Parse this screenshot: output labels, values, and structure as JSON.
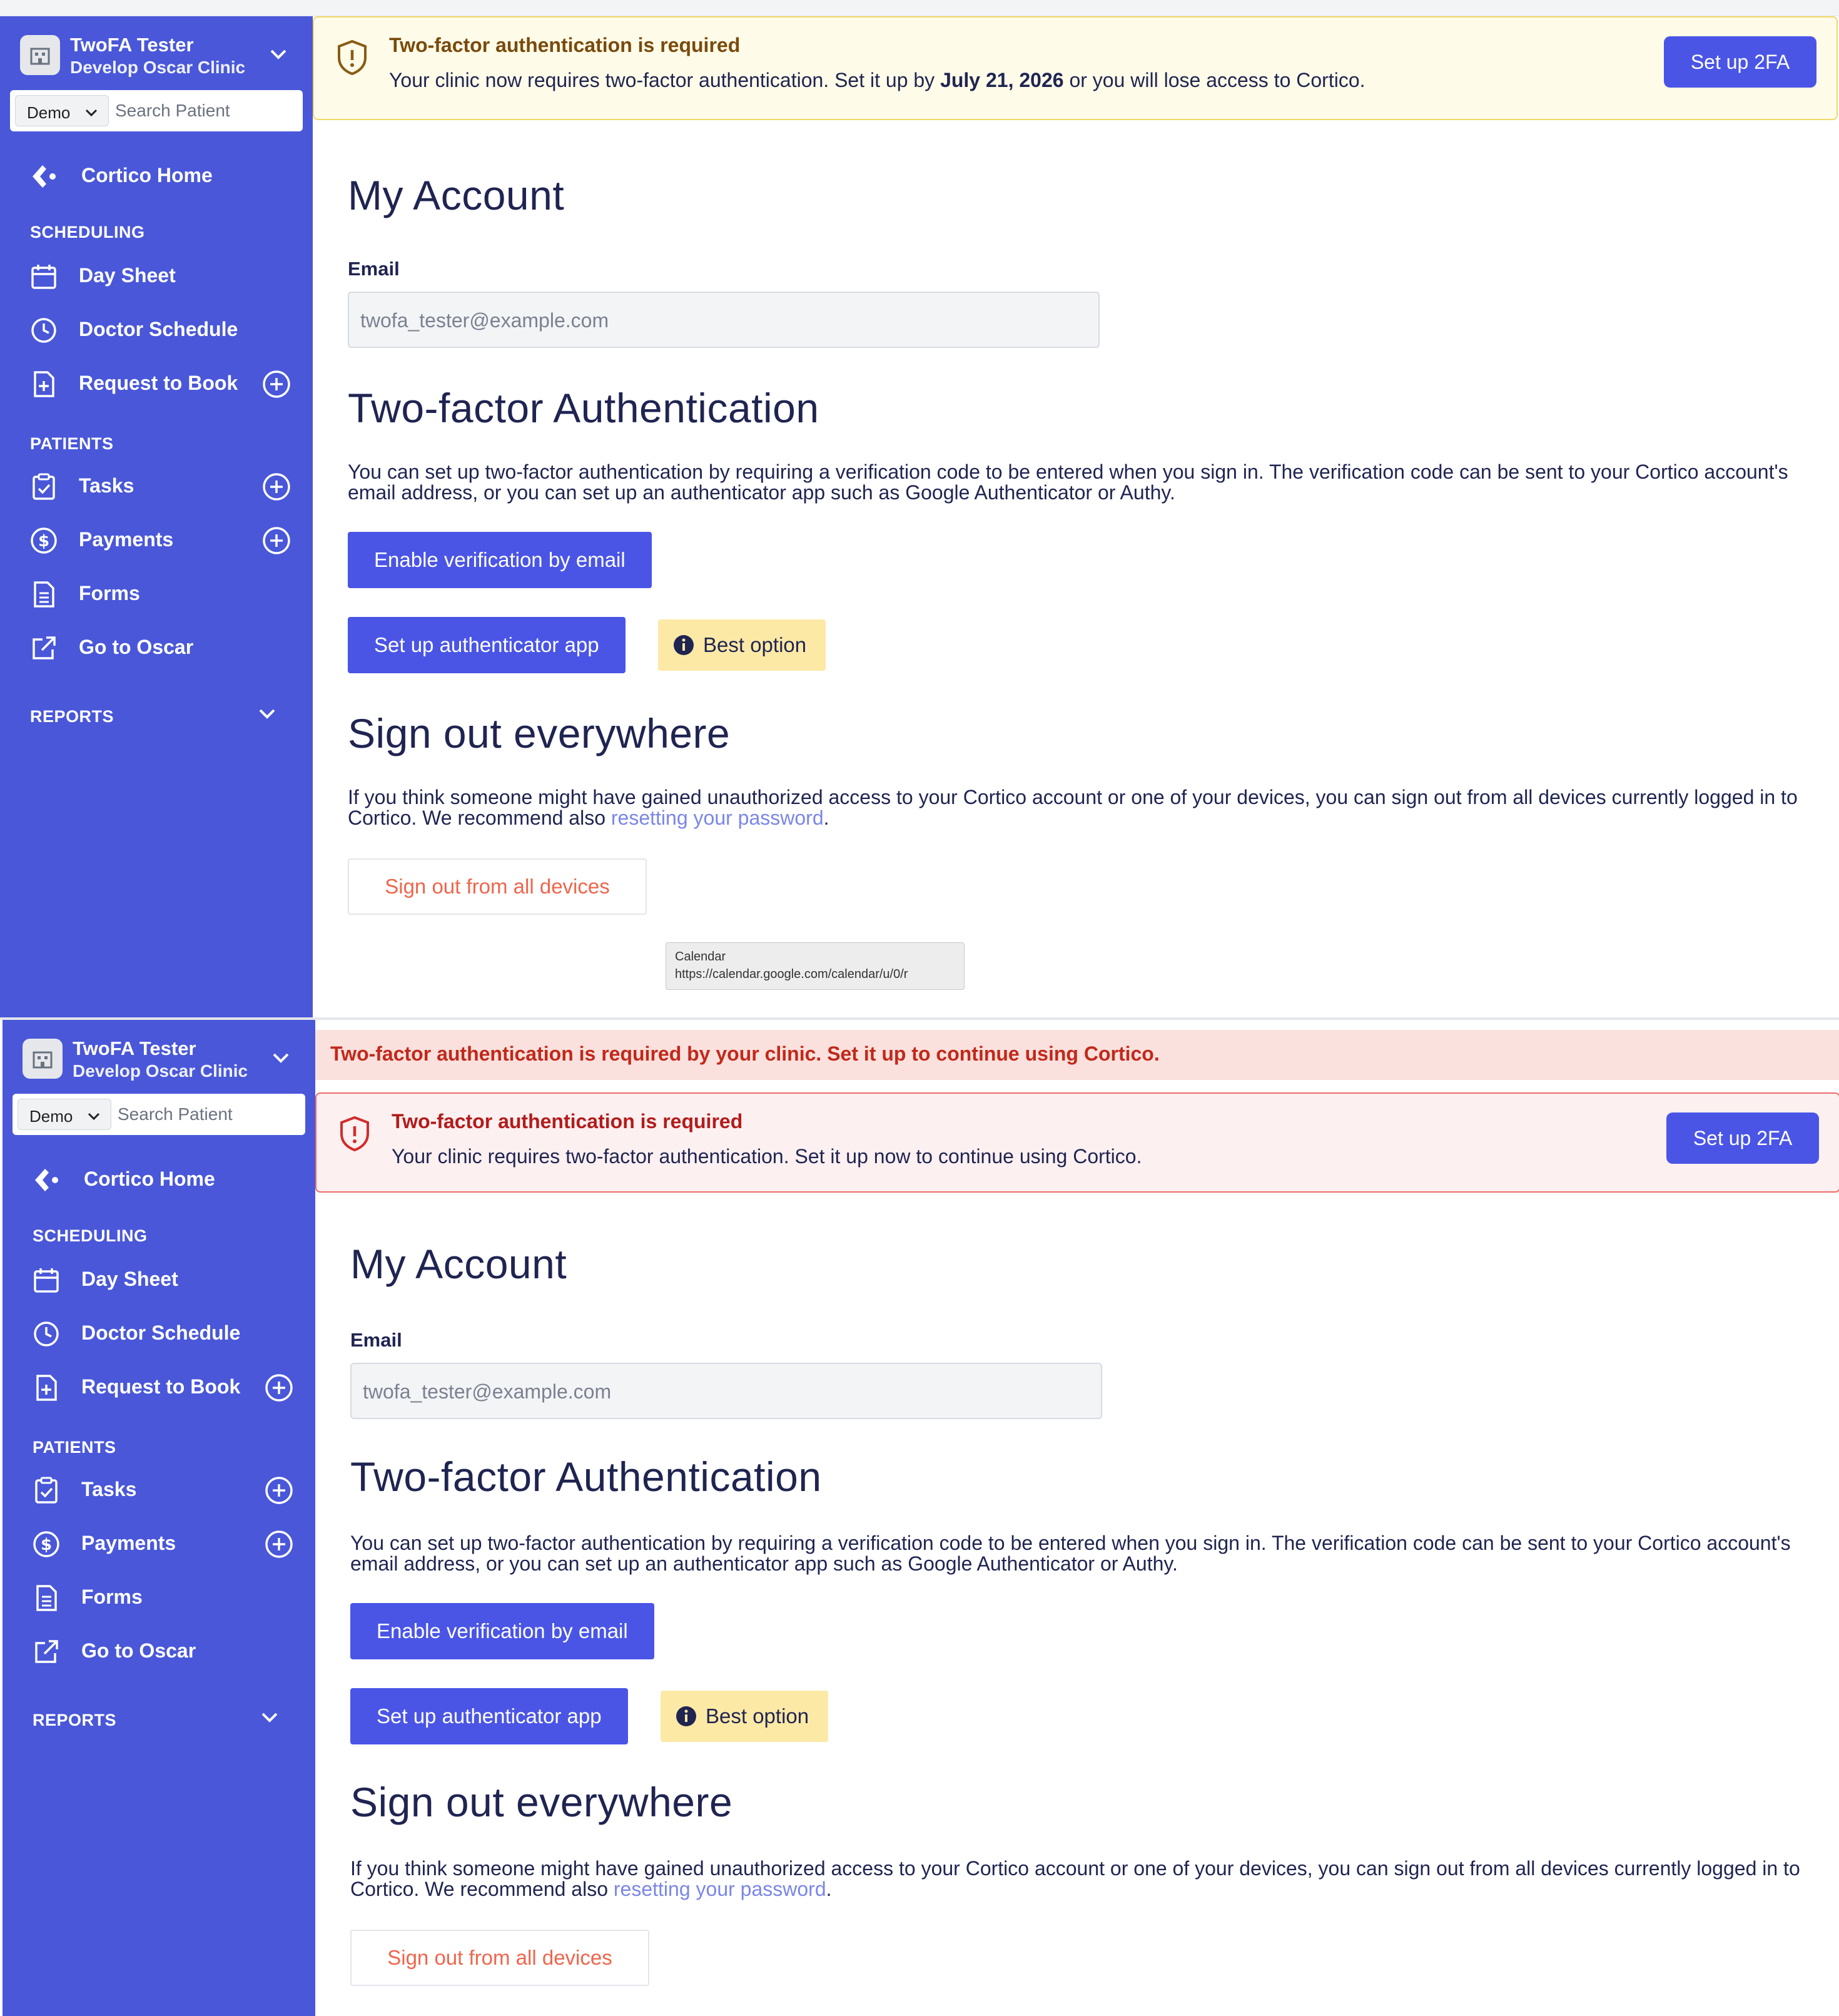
{
  "sidebar": {
    "user_name": "TwoFA Tester",
    "clinic_name": "Develop Oscar Clinic",
    "demo_select": "Demo",
    "search_placeholder": "Search Patient",
    "home_label": "Cortico Home",
    "scheduling_header": "SCHEDULING",
    "day_sheet": "Day Sheet",
    "doctor_schedule": "Doctor Schedule",
    "request_to_book": "Request to Book",
    "patients_header": "PATIENTS",
    "tasks": "Tasks",
    "payments": "Payments",
    "forms": "Forms",
    "go_to_oscar": "Go to Oscar",
    "reports_header": "REPORTS"
  },
  "top_banner": {
    "title": "Two-factor authentication is required",
    "text_before": "Your clinic now requires two-factor authentication. Set it up by ",
    "deadline": "July 21, 2026",
    "text_after": " or you will lose access to Cortico.",
    "button": "Set up 2FA"
  },
  "bottom_strip": {
    "text": "Two-factor authentication is required by your clinic. Set it up to continue using Cortico."
  },
  "bottom_banner": {
    "title": "Two-factor authentication is required",
    "text": "Your clinic requires two-factor authentication. Set it up now to continue using Cortico.",
    "button": "Set up 2FA"
  },
  "account": {
    "title": "My Account",
    "email_label": "Email",
    "email_value": "twofa_tester@example.com",
    "tfa_title": "Two-factor Authentication",
    "tfa_description": "You can set up two-factor authentication by requiring a verification code to be entered when you sign in. The verification code can be sent to your Cortico account's email address, or you can set up an authenticator app such as Google Authenticator or Authy.",
    "enable_email_button": "Enable verification by email",
    "authenticator_button": "Set up authenticator app",
    "best_option": "Best option",
    "signout_title": "Sign out everywhere",
    "signout_text": "If you think someone might have gained unauthorized access to your Cortico account or one of your devices, you can sign out from all devices currently logged in to Cortico. We recommend also ",
    "reset_link": "resetting your password",
    "signout_period": ".",
    "signout_button": "Sign out from all devices"
  },
  "tooltip": {
    "title": "Calendar",
    "url": "https://calendar.google.com/calendar/u/0/r"
  },
  "colors": {
    "sidebar": "#4957d8",
    "primary": "#4a55e6",
    "warn_bg": "#fefbe8",
    "error_bg": "#fdf0f0",
    "error_text": "#c2281a",
    "link": "#7a86e8",
    "badge": "#fde9a6"
  }
}
